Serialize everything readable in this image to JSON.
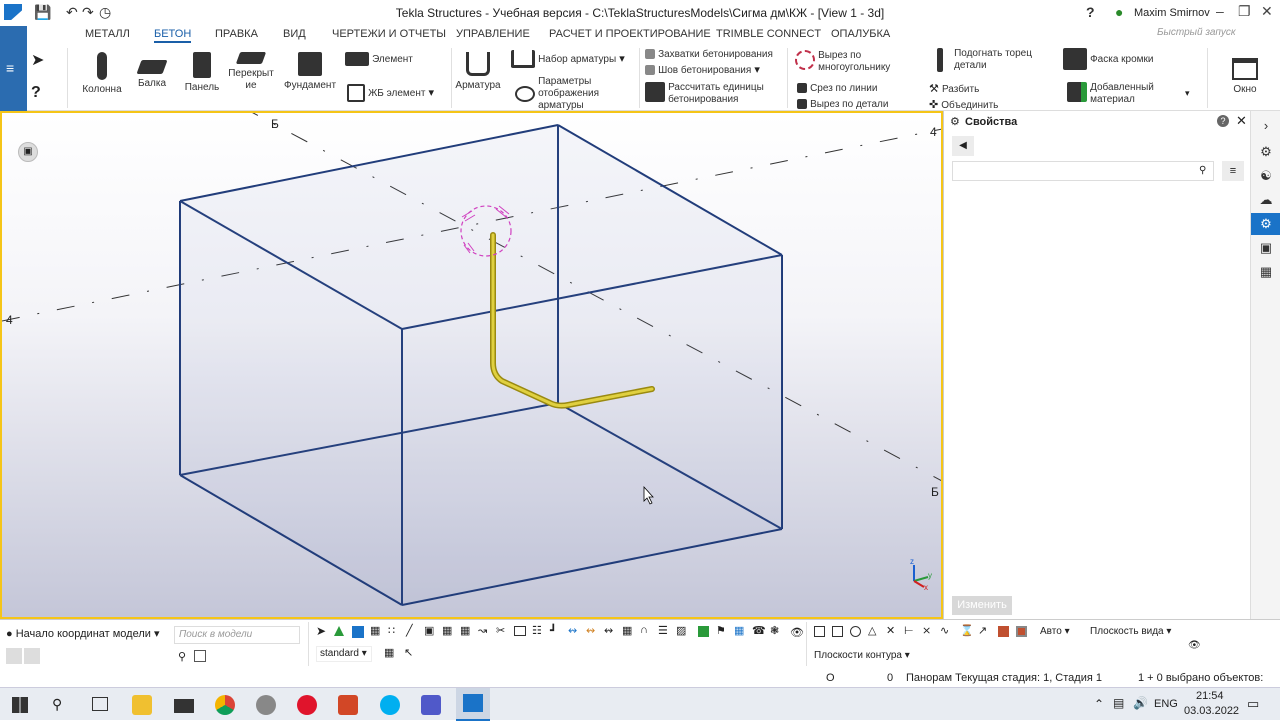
{
  "window": {
    "title": "Tekla Structures - Учебная версия - C:\\TeklaStructuresModels\\Сигма дм\\КЖ  - [View 1 - 3d]",
    "user": "Maxim Smirnov"
  },
  "tabs": [
    "МЕТАЛЛ",
    "БЕТОН",
    "ПРАВКА",
    "ВИД",
    "ЧЕРТЕЖИ И ОТЧЕТЫ",
    "УПРАВЛЕНИЕ",
    "РАСЧЕТ И ПРОЕКТИРОВАНИЕ",
    "TRIMBLE CONNECT",
    "ОПАЛУБКА"
  ],
  "active_tab": "БЕТОН",
  "quick_search_placeholder": "Быстрый запуск",
  "ribbon": {
    "column": "Колонна",
    "beam": "Балка",
    "panel": "Панель",
    "slab": "Перекрыт ие",
    "foundation": "Фундамент",
    "element": "Элемент",
    "rc_element": "ЖБ элемент",
    "rebar": "Арматура",
    "rebar_set": "Набор арматуры",
    "rebar_display": "Параметры отображения арматуры",
    "pour_breaks": "Захватки бетонирования",
    "pour_joint": "Шов бетонирования",
    "calc_pour_units": "Рассчитать единицы бетонирования",
    "polygon_cut": "Вырез по многоугольнику",
    "line_cut": "Срез по линии",
    "part_cut": "Вырез по детали",
    "fit_end": "Подогнать торец детали",
    "split": "Разбить",
    "combine": "Объединить",
    "chamfer": "Фаска кромки",
    "added_material": "Добавленный материал",
    "window": "Окно"
  },
  "viewport": {
    "grid_labels": {
      "b_top": "Б",
      "four_left": "4",
      "four_right": "4",
      "b_right": "Б"
    },
    "axis_labels": {
      "z": "z",
      "y": "y",
      "x": "x"
    }
  },
  "properties": {
    "title": "Свойства",
    "modify_button": "Изменить"
  },
  "bottom": {
    "origin": "Начало координат модели",
    "search_placeholder": "Поиск в модели",
    "standard": "standard",
    "auto": "Авто",
    "view_plane": "Плоскость вида",
    "contour_planes": "Плоскости контура"
  },
  "status": {
    "o": "O",
    "zero": "0",
    "stage_text": "Панорам Текущая стадия: 1, Стадия 1",
    "selected_text": "1 + 0 выбрано объектов:"
  },
  "taskbar": {
    "lang": "ENG",
    "time": "21:54",
    "date": "03.03.2022"
  },
  "colors": {
    "accent": "#1a73c8",
    "viewport_border": "#f5c518",
    "box_edge": "#1e3a78",
    "rebar": "#d4c030",
    "dashed_line": "#333333"
  }
}
